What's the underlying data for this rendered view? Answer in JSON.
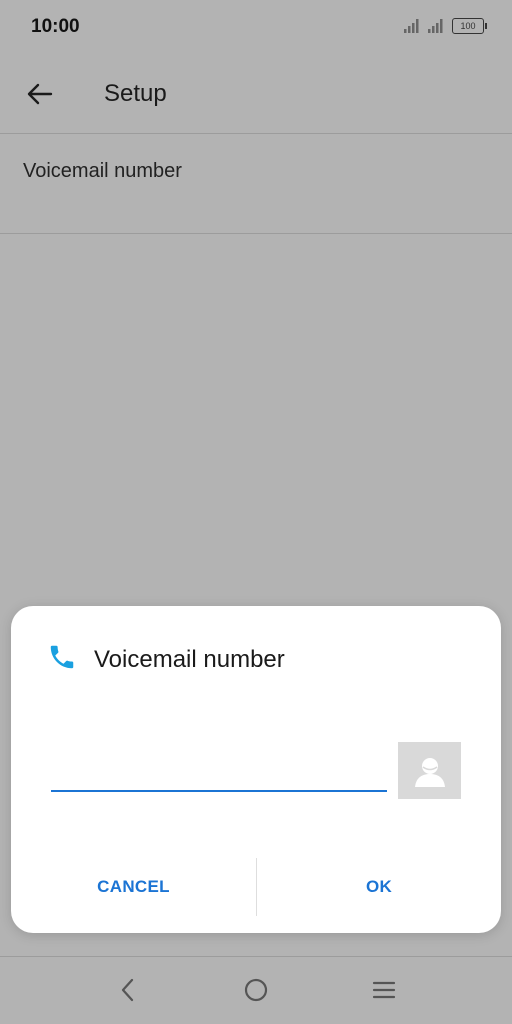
{
  "status_bar": {
    "time": "10:00",
    "battery": "100",
    "icons": [
      "signal-icon",
      "signal-icon",
      "battery-icon"
    ]
  },
  "app_bar": {
    "title": "Setup",
    "back_icon": "arrow-back-icon"
  },
  "settings": {
    "items": [
      {
        "label": "Voicemail number"
      }
    ]
  },
  "dialog": {
    "icon": "phone-icon",
    "title": "Voicemail number",
    "input_value": "",
    "contact_icon": "contact-icon",
    "cancel_label": "CANCEL",
    "ok_label": "OK"
  },
  "nav_bar": {
    "icons": [
      "back-icon",
      "home-icon",
      "menu-icon"
    ]
  },
  "colors": {
    "accent": "#1b74d4",
    "phone_icon": "#1aa0e0",
    "scrim": "#b3b3b3"
  }
}
